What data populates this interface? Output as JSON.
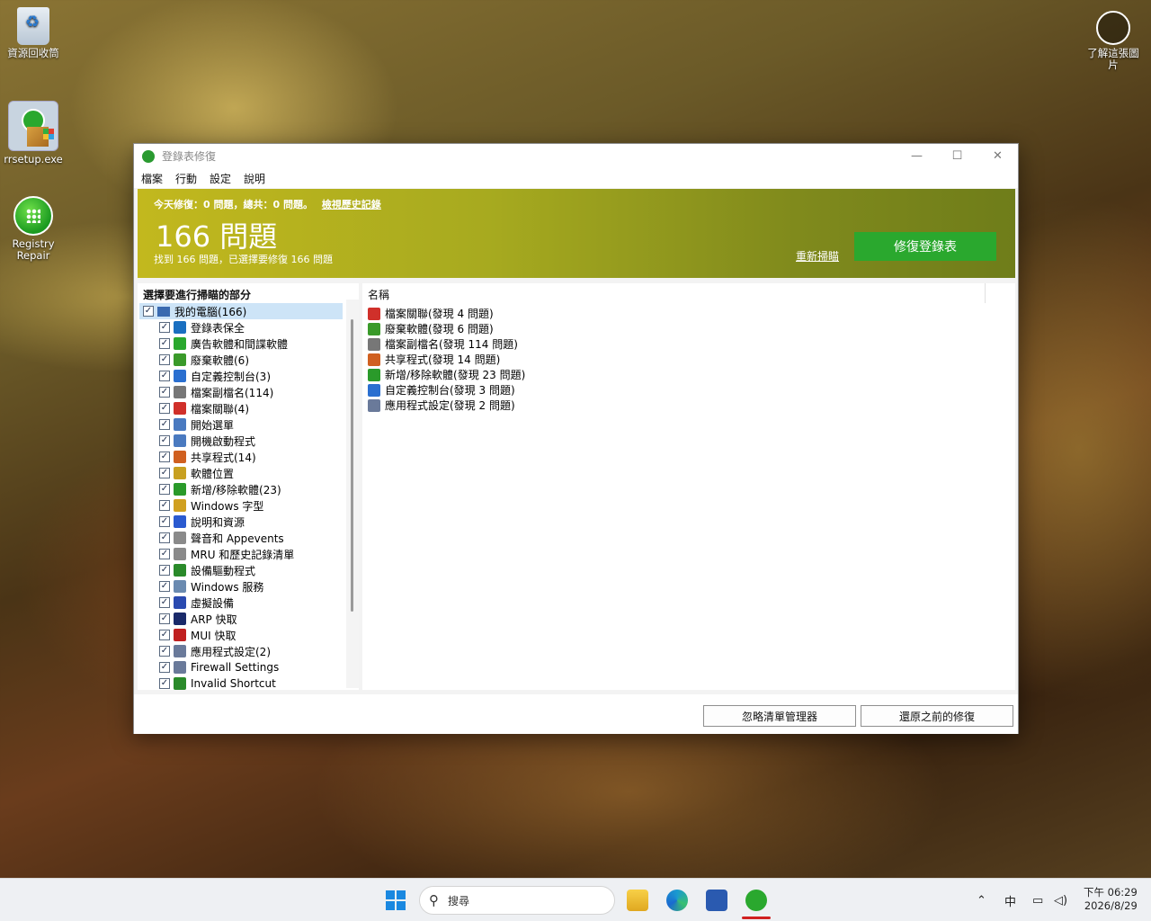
{
  "desktop": {
    "recycle_bin": "資源回收筒",
    "rrsetup": "rrsetup.exe",
    "registry_repair_line1": "Registry",
    "registry_repair_line2": "Repair",
    "learn_line1": "了解這張圖",
    "learn_line2": "片"
  },
  "window": {
    "title": "登錄表修復",
    "controls": {
      "minimize": "—",
      "maximize": "☐",
      "close": "✕"
    },
    "menu": [
      "檔案",
      "行動",
      "設定",
      "說明"
    ]
  },
  "banner": {
    "stats": "今天修復：0 問題，總共：0 問題。",
    "history_link": "檢視歷史記錄",
    "count_label": "166 問題",
    "sub_text": "找到 166 問題，已選擇要修復 166 問題",
    "rescan_link": "重新掃瞄",
    "fix_button": "修復登錄表"
  },
  "left_panel": {
    "header": "選擇要進行掃瞄的部分",
    "root": "我的電腦(166)",
    "items": [
      {
        "label": "登錄表保全",
        "icon": "grid-icon",
        "color": "#1a6fc0"
      },
      {
        "label": "廣告軟體和間諜軟體",
        "icon": "shield-icon",
        "color": "#2aa82e"
      },
      {
        "label": "廢棄軟體(6)",
        "icon": "trash-icon",
        "color": "#3a9a2a"
      },
      {
        "label": "自定義控制台(3)",
        "icon": "blocks-icon",
        "color": "#2a6fd0"
      },
      {
        "label": "檔案副檔名(114)",
        "icon": "file-icon",
        "color": "#777777"
      },
      {
        "label": "檔案關聯(4)",
        "icon": "pdf-icon",
        "color": "#d0302a"
      },
      {
        "label": "開始選單",
        "icon": "menu-icon",
        "color": "#4a7ac0"
      },
      {
        "label": "開機啟動程式",
        "icon": "window-icon",
        "color": "#4a7ac0"
      },
      {
        "label": "共享程式(14)",
        "icon": "share-icon",
        "color": "#d06020"
      },
      {
        "label": "軟體位置",
        "icon": "folder-icon",
        "color": "#c8a020"
      },
      {
        "label": "新增/移除軟體(23)",
        "icon": "recycle-icon",
        "color": "#2a9a2a"
      },
      {
        "label": "Windows 字型",
        "icon": "font-icon",
        "color": "#d0a020"
      },
      {
        "label": "說明和資源",
        "icon": "help-icon",
        "color": "#2a5ad0"
      },
      {
        "label": "聲音和 Appevents",
        "icon": "sound-icon",
        "color": "#8a8a8a"
      },
      {
        "label": "MRU 和歷史記錄清單",
        "icon": "history-icon",
        "color": "#8a8a8a"
      },
      {
        "label": "設備驅動程式",
        "icon": "chip-icon",
        "color": "#2a8a2a"
      },
      {
        "label": "Windows 服務",
        "icon": "service-icon",
        "color": "#6a8ab0"
      },
      {
        "label": "虛擬設備",
        "icon": "device-icon",
        "color": "#2a4ab0"
      },
      {
        "label": "ARP 快取",
        "icon": "arp-icon",
        "color": "#1a2a6a"
      },
      {
        "label": "MUI 快取",
        "icon": "mui-icon",
        "color": "#c02020"
      },
      {
        "label": "應用程式設定(2)",
        "icon": "settings-icon",
        "color": "#6a7a9a"
      },
      {
        "label": "Firewall Settings",
        "icon": "firewall-icon",
        "color": "#6a7a9a"
      },
      {
        "label": "Invalid Shortcut",
        "icon": "shortcut-icon",
        "color": "#2a8a2a"
      }
    ]
  },
  "right_panel": {
    "column_name": "名稱",
    "results": [
      {
        "label": "檔案關聯(發現 4 問題)",
        "icon": "pdf-icon",
        "color": "#d0302a"
      },
      {
        "label": "廢棄軟體(發現 6 問題)",
        "icon": "trash-icon",
        "color": "#3a9a2a"
      },
      {
        "label": "檔案副檔名(發現 114 問題)",
        "icon": "file-icon",
        "color": "#777777"
      },
      {
        "label": "共享程式(發現 14 問題)",
        "icon": "share-icon",
        "color": "#d06020"
      },
      {
        "label": "新增/移除軟體(發現 23 問題)",
        "icon": "recycle-icon",
        "color": "#2a9a2a"
      },
      {
        "label": "自定義控制台(發現 3 問題)",
        "icon": "blocks-icon",
        "color": "#2a6fd0"
      },
      {
        "label": "應用程式設定(發現 2 問題)",
        "icon": "settings-icon",
        "color": "#6a7a9a"
      }
    ]
  },
  "footer": {
    "ignore_button": "忽略清單管理器",
    "restore_button": "還原之前的修復"
  },
  "taskbar": {
    "search_placeholder": "搜尋",
    "ime": "中",
    "time": "下午 06:29",
    "date": "2026/8/29"
  },
  "colors": {
    "accent_green": "#2aa82e",
    "banner_start": "#c2b81e",
    "banner_end": "#6f7d1a"
  }
}
